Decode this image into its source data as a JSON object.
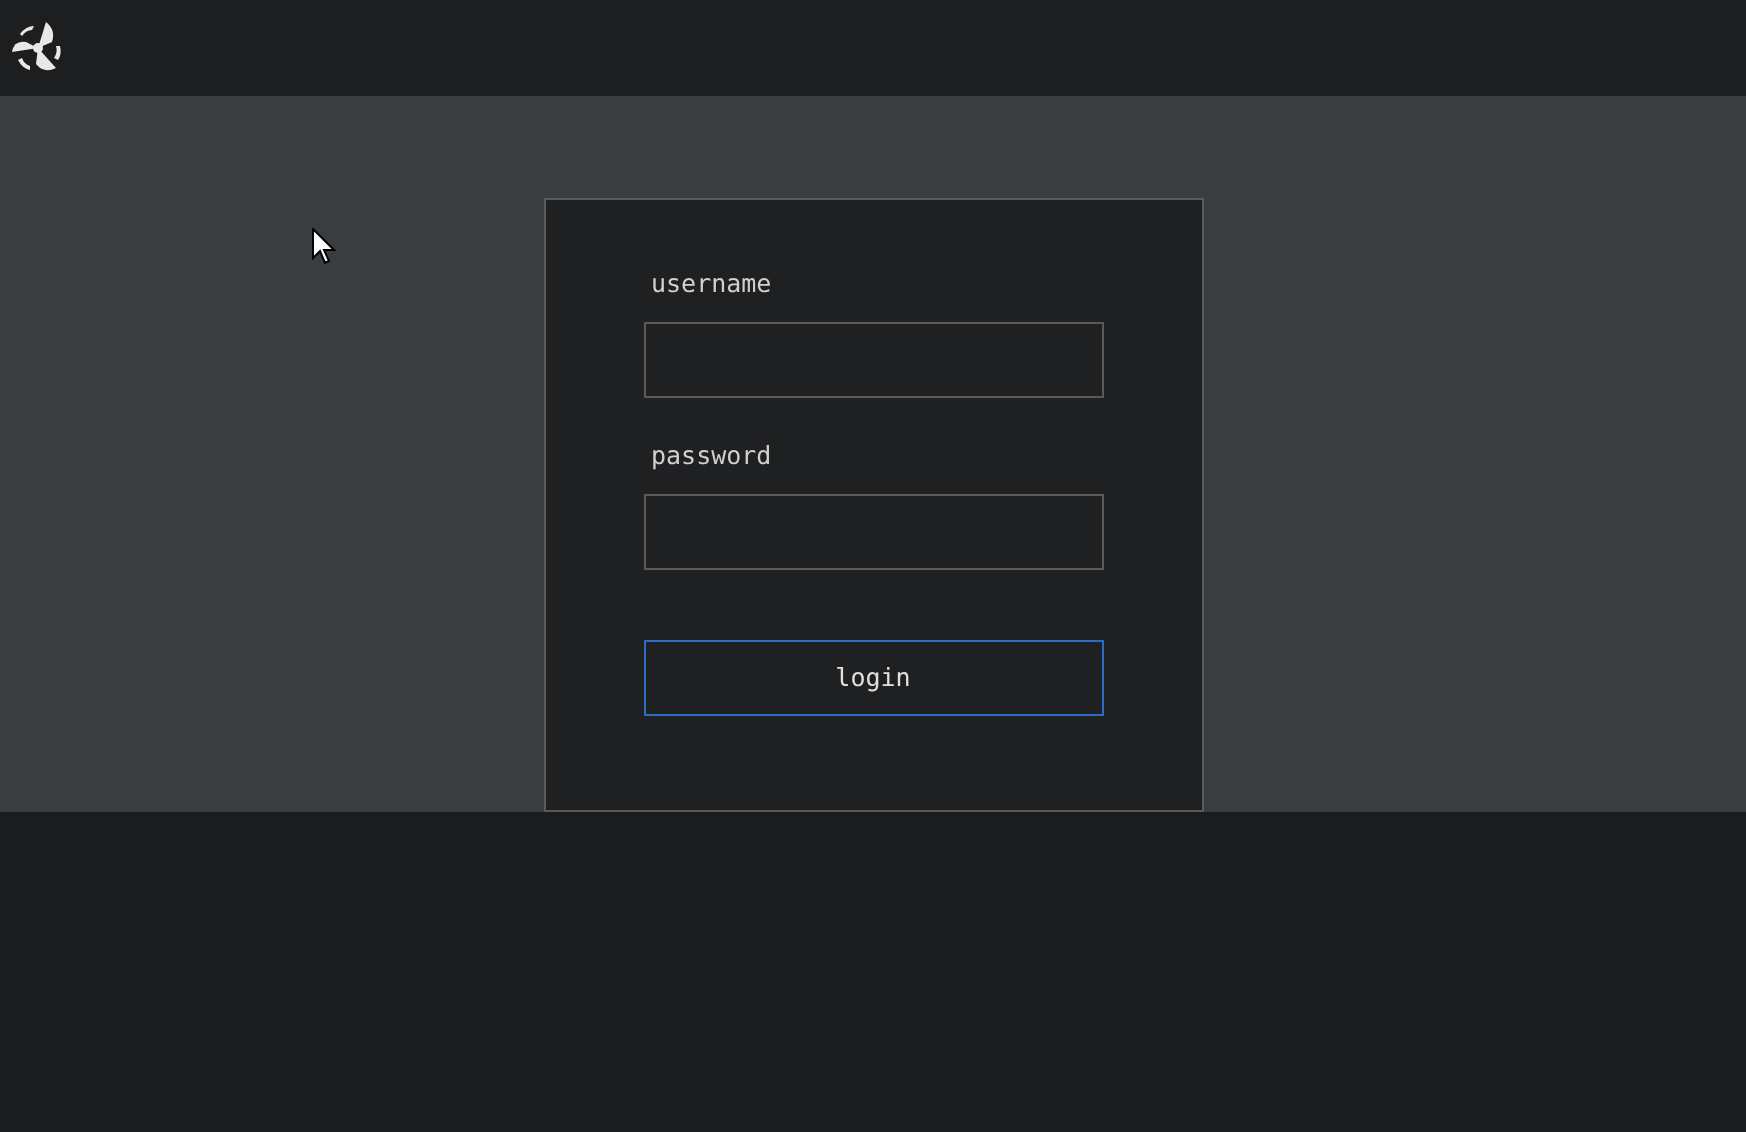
{
  "login_form": {
    "fields": [
      {
        "label": "username"
      },
      {
        "label": "password"
      }
    ],
    "submit_button": "login"
  }
}
